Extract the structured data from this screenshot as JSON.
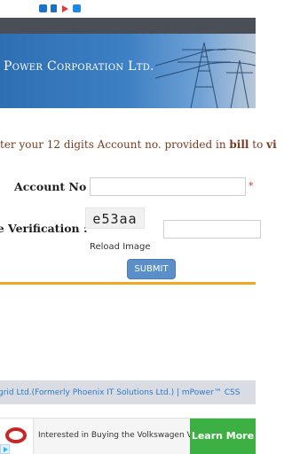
{
  "banner": {
    "title": "Power Corporation Ltd."
  },
  "form": {
    "instruction_pre": "ter your 12 digits Account no. provided in ",
    "instruction_bold1": "bill",
    "instruction_mid": " to ",
    "instruction_bold2": "vi",
    "account_label": "Account No :",
    "account_value": "",
    "required_mark": "*",
    "image_label": "ge Verification :",
    "captcha_text": "e53aa",
    "captcha_value": "",
    "reload_label": "Reload Image",
    "submit_label": "SUBMIT"
  },
  "footer": {
    "text": "grid Ltd.(Formerly Phoenix IT Solutions Ltd.) | mPower™ CSS"
  },
  "ad": {
    "text": "Interested in Buying the Volkswagen Vento?",
    "button_label": "Learn More"
  },
  "colors": {
    "banner_blue": "#3e80c4",
    "accent_red": "#c62828",
    "orange_line": "#f5a623",
    "submit_blue": "#5b8fc9",
    "ad_green": "#3cb043",
    "footer_link": "#2c79c6"
  }
}
